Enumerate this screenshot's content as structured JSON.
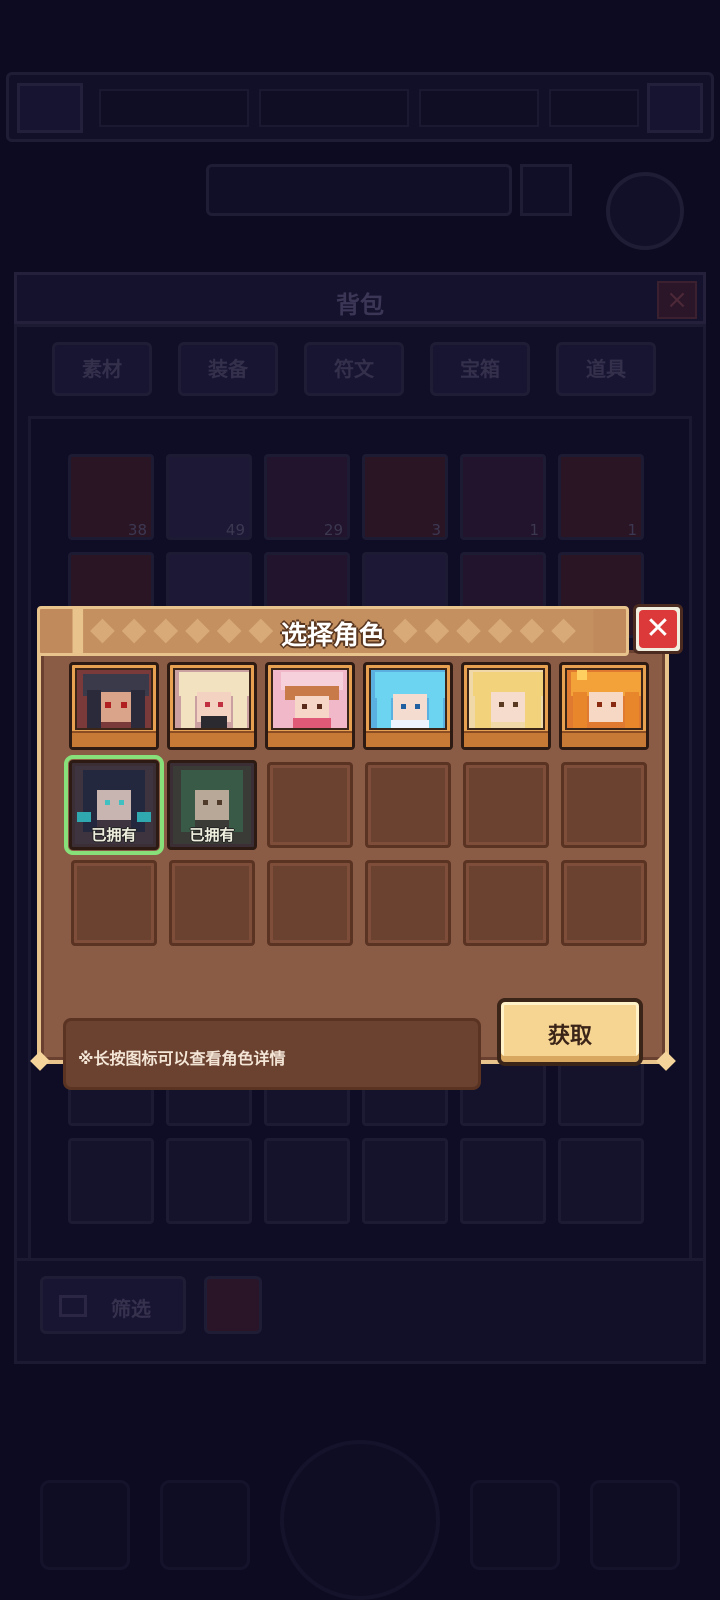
{
  "background": {
    "search_placeholder": "",
    "bag": {
      "title": "背包",
      "tabs": [
        "素材",
        "装备",
        "符文",
        "宝箱",
        "道具"
      ],
      "item_counts": [
        "38",
        "49",
        "29",
        "3",
        "1",
        "1"
      ]
    },
    "filter_label": "筛选"
  },
  "dialog": {
    "title": "选择角色",
    "close_symbol": "✕",
    "owned_label": "已拥有",
    "hint": "※长按图标可以查看角色详情",
    "get_button": "获取"
  },
  "colors": {
    "accent_green": "#88e07a",
    "close_red": "#dc3a3a",
    "button_gold": "#f6d592"
  }
}
